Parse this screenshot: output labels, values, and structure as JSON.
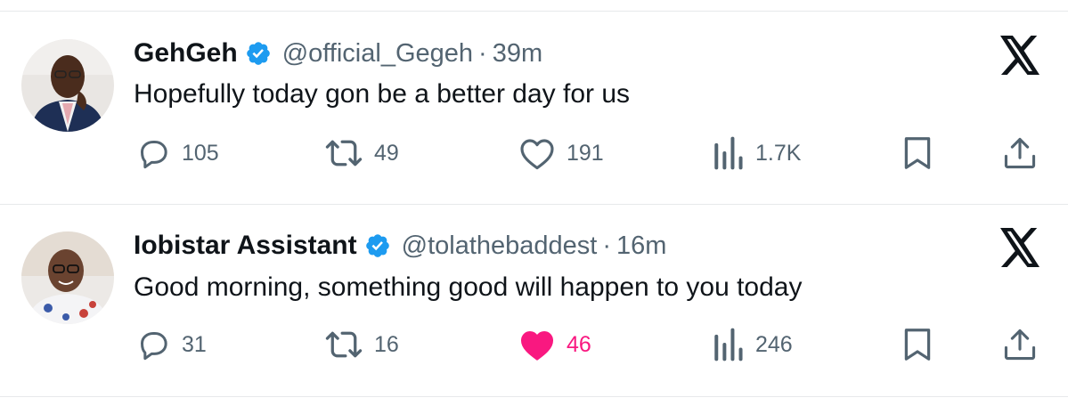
{
  "tweets": [
    {
      "name": "GehGeh",
      "handle": "@official_Gegeh",
      "separator": "·",
      "time": "39m",
      "text": "Hopefully today gon be a better day for us",
      "replies": "105",
      "retweets": "49",
      "likes": "191",
      "views": "1.7K",
      "liked": false
    },
    {
      "name": "Iobistar Assistant",
      "handle": "@tolathebaddest",
      "separator": "·",
      "time": "16m",
      "text": "Good morning, something good will happen to you today",
      "replies": "31",
      "retweets": "16",
      "likes": "46",
      "views": "246",
      "liked": true
    }
  ],
  "colors": {
    "text": "#0f1419",
    "muted": "#536471",
    "verified": "#1d9bf0",
    "like": "#f91880",
    "divider": "#e7e9eb"
  },
  "icons": [
    "verified-badge-icon",
    "x-logo-icon",
    "reply-icon",
    "retweet-icon",
    "heart-icon",
    "views-icon",
    "bookmark-icon",
    "share-icon"
  ]
}
